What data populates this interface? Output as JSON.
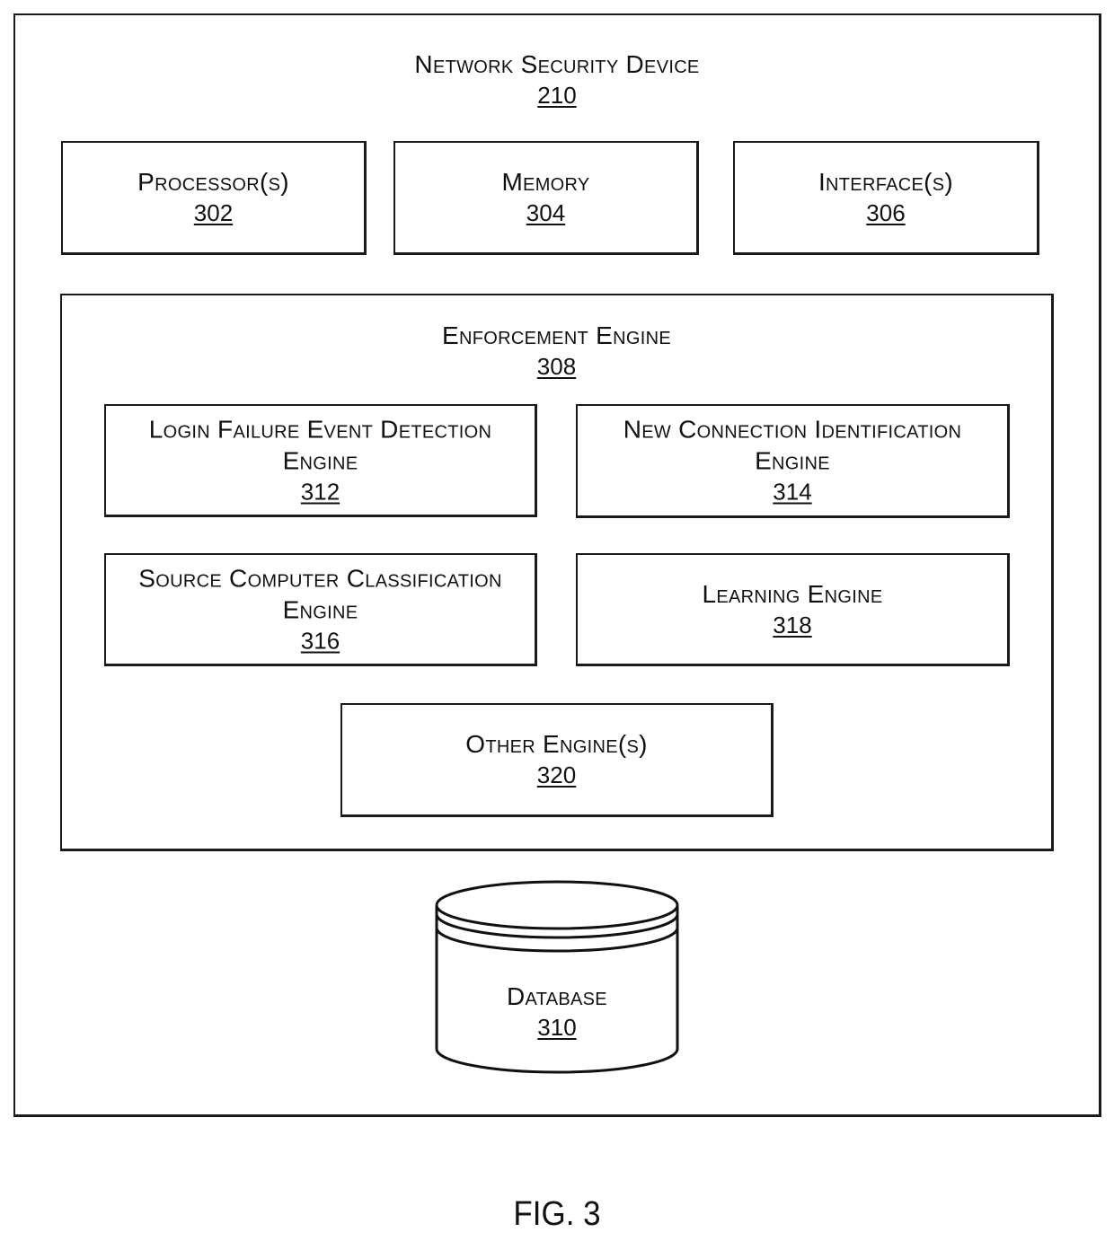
{
  "figure": {
    "caption": "FIG. 3"
  },
  "device": {
    "title": "Network Security Device",
    "ref": "210"
  },
  "components": {
    "processor": {
      "title": "Processor(s)",
      "ref": "302"
    },
    "memory": {
      "title": "Memory",
      "ref": "304"
    },
    "interface": {
      "title": "Interface(s)",
      "ref": "306"
    }
  },
  "enforcement_engine": {
    "title": "Enforcement Engine",
    "ref": "308",
    "engines": {
      "login_failure": {
        "line1": "Login Failure Event Detection",
        "line2": "Engine",
        "ref": "312"
      },
      "new_connection": {
        "line1": "New Connection Identification",
        "line2": "Engine",
        "ref": "314"
      },
      "source_computer": {
        "line1": "Source Computer Classification",
        "line2": "Engine",
        "ref": "316"
      },
      "learning": {
        "title": "Learning Engine",
        "ref": "318"
      },
      "other": {
        "title": "Other Engine(s)",
        "ref": "320"
      }
    }
  },
  "database": {
    "title": "Database",
    "ref": "310",
    "icon": "database-cylinder-icon"
  }
}
